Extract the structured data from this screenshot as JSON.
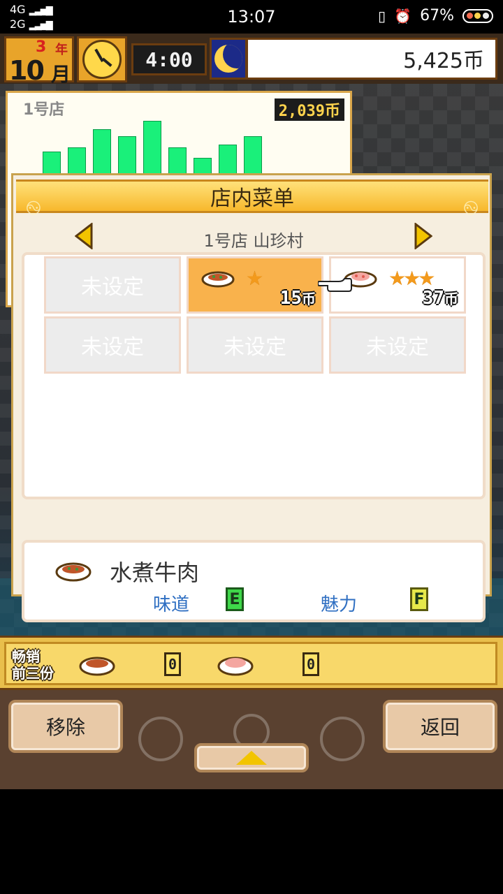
{
  "status_bar": {
    "network_1": "4G",
    "network_2": "2G",
    "time": "13:07",
    "battery": "67%",
    "icons": [
      "vibrate-icon",
      "alarm-icon",
      "battery-icon"
    ]
  },
  "hud": {
    "year": "3",
    "year_unit": "年",
    "month": "10",
    "month_unit": "月",
    "game_time": "4:00",
    "money": "5,425币",
    "icons": [
      "clock-icon",
      "moon-icon"
    ]
  },
  "sales_panel": {
    "shop_name": "1号店",
    "revenue": "2,039币",
    "bar_levels": [
      0.45,
      0.52,
      0.85,
      0.72,
      1.0,
      0.52,
      0.34,
      0.57,
      0.72
    ]
  },
  "menu_popup": {
    "title": "店内菜单",
    "shop_label": "1号店 山珍村",
    "slots": [
      {
        "label": "未设定"
      },
      {
        "dish": "bowl-dish-icon",
        "stars": "★",
        "price": "15",
        "unit": "币",
        "selected": true
      },
      {
        "dish": "shrimp-dish-icon",
        "stars": "★★★",
        "price": "37",
        "unit": "币"
      },
      {
        "label": "未设定"
      },
      {
        "label": "未设定"
      },
      {
        "label": "未设定"
      }
    ],
    "detail": {
      "dish_name": "水煮牛肉",
      "taste_label": "味道",
      "taste_grade": "E",
      "charm_label": "魅力",
      "charm_grade": "F"
    }
  },
  "best_sellers": {
    "label_line1": "畅销",
    "label_line2": "前三份",
    "items": [
      {
        "dish": "bowl-dish-icon",
        "count": "0"
      },
      {
        "dish": "shrimp-dish-icon",
        "count": "0"
      }
    ]
  },
  "buttons": {
    "remove": "移除",
    "back": "返回"
  },
  "colors": {
    "gold": "#f7b82c",
    "bar_green": "#1af07a",
    "selected_slot": "#f9b24c",
    "label_blue": "#2f6fc2"
  }
}
